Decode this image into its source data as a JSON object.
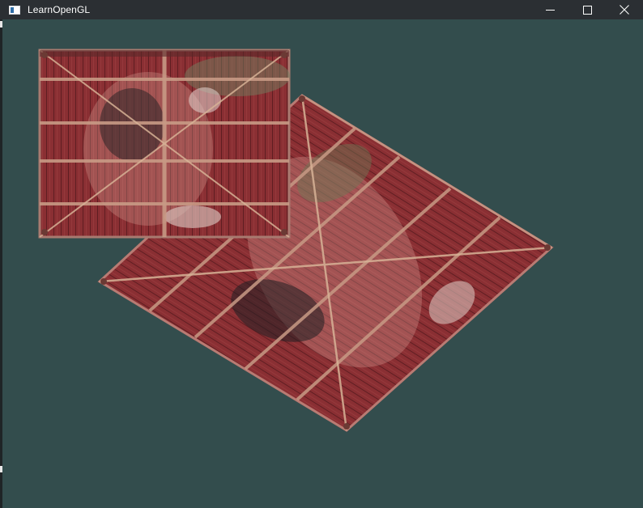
{
  "window": {
    "title": "LearnOpenGL",
    "icon": "window-app-icon",
    "controls": [
      "minimize-icon",
      "maximize-icon",
      "close-icon"
    ]
  },
  "scene": {
    "clear_color": "#334d4d",
    "objects": [
      {
        "name": "front-crate",
        "texture": "wooden-container-blended-with-face"
      },
      {
        "name": "rotated-crate",
        "texture": "wooden-container-blended-with-face"
      }
    ]
  }
}
